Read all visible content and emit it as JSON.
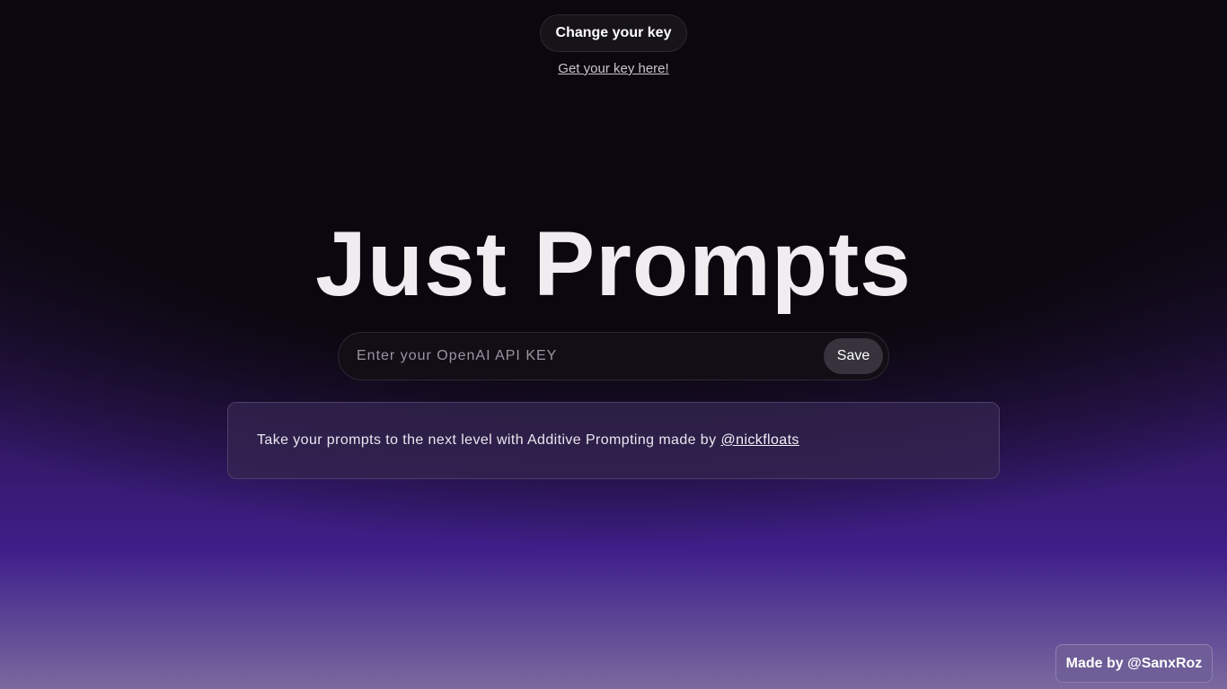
{
  "header": {
    "change_key_label": "Change your key",
    "get_key_link": "Get your key here!"
  },
  "main": {
    "title": "Just Prompts",
    "api_key_input": {
      "value": "",
      "placeholder": "Enter your OpenAI API KEY"
    },
    "save_label": "Save",
    "info_text": "Take your prompts to the next level with Additive Prompting made by",
    "info_link": "@nickfloats"
  },
  "footer": {
    "made_by": "Made by @SanxRoz"
  },
  "colors": {
    "background_top": "#0b070e",
    "background_purple": "#3f1f8a",
    "background_bottom": "#7b6a9e",
    "title_text": "#efedf0"
  }
}
